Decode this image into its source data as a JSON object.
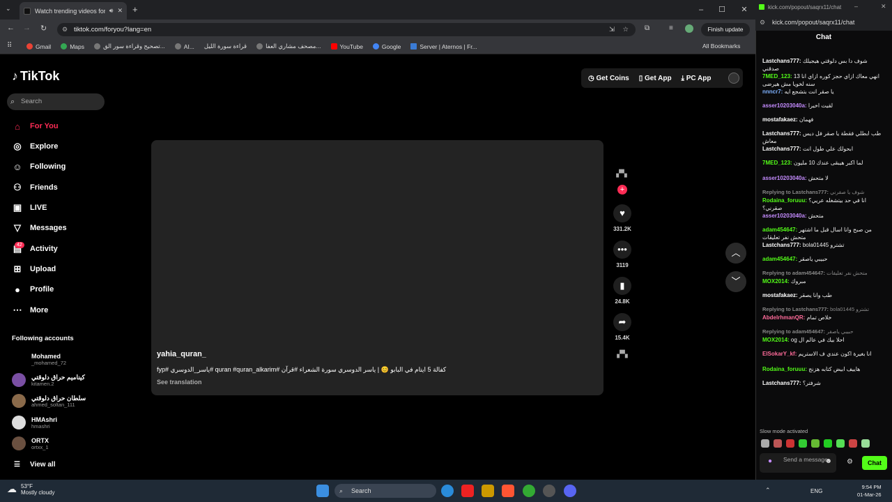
{
  "browser": {
    "tab_title": "Watch trending videos for y",
    "url": "tiktok.com/foryou?lang=en",
    "finish_update": "Finish update",
    "bookmarks": [
      "Gmail",
      "Maps",
      "تصحيح وقراءة سور الق...",
      "AI...",
      "قراءة سورة الليل",
      "مصحف مشاري العفا...",
      "YouTube",
      "Google",
      "Server | Aternos | Fr..."
    ],
    "all_bookmarks": "All Bookmarks"
  },
  "tiktok": {
    "logo": "TikTok",
    "search_placeholder": "Search",
    "nav": [
      {
        "label": "For You",
        "icon": "home-icon"
      },
      {
        "label": "Explore",
        "icon": "compass-icon"
      },
      {
        "label": "Following",
        "icon": "person-icon"
      },
      {
        "label": "Friends",
        "icon": "friends-icon"
      },
      {
        "label": "LIVE",
        "icon": "live-icon"
      },
      {
        "label": "Messages",
        "icon": "send-icon"
      },
      {
        "label": "Activity",
        "icon": "inbox-icon"
      },
      {
        "label": "Upload",
        "icon": "plus-square-icon"
      },
      {
        "label": "Profile",
        "icon": "profile-icon"
      },
      {
        "label": "More",
        "icon": "more-icon"
      }
    ],
    "activity_badge": "42",
    "following_header": "Following accounts",
    "accounts": [
      {
        "name": "Mohamed",
        "handle": "_mohamed_72"
      },
      {
        "name": "كيناميم حراق دلوقتي",
        "handle": "kitamen.2"
      },
      {
        "name": "سلطان حراق دلوقتي",
        "handle": "ahmed_soltan_111"
      },
      {
        "name": "HMAshri",
        "handle": "hmashri"
      },
      {
        "name": "ORTX",
        "handle": "ortxx_1"
      }
    ],
    "view_all": "View all",
    "top_buttons": [
      "Get Coins",
      "Get App",
      "PC App"
    ],
    "video": {
      "username": "yahia_quran_",
      "caption": "كفالة 5 ايتام في البابو 😊 | ياسر الدوسري سورة الشعراء #قرآن #quran #quran_alkarim #ياسر_الدوسري #fyp",
      "see_translation": "See translation",
      "likes": "331.2K",
      "comments": "3119",
      "saves": "24.8K",
      "shares": "15.4K"
    }
  },
  "chat": {
    "window_title": "kick.com/popout/saqrx11/chat",
    "url": "kick.com/popout/saqrx11/chat",
    "header": "Chat",
    "messages": [
      {
        "user": "Lastchans777:",
        "text": "شوف دا بس دلوقتي هيجيلك صدقني",
        "color": "#ffffff"
      },
      {
        "user": "7MED_123:",
        "text": "انهي معاك ازاي حجز كوره ازاي انا 13 سنه لخويا مش هيرضى",
        "color": "#53fc18"
      },
      {
        "user": "nnncr7:",
        "text": "يا صقر انت بتشجع ايه",
        "color": "#7fb2ff"
      },
      {
        "user": "asser10203040a:",
        "text": "لقيت اخيرا",
        "color": "#c58cff"
      },
      {
        "user": "mostafakaez:",
        "text": "فهمان",
        "color": "#ffffff"
      },
      {
        "user": "Lastchans777:",
        "text": "طب ابطلي فقطة يا صقر فل ديس معاش",
        "color": "#ffffff"
      },
      {
        "user": "Lastchans777:",
        "text": "ابحولك علي طول انت",
        "color": "#ffffff"
      },
      {
        "user": "7MED_123:",
        "text": "لما اكبر هيبقى عندك 10 مليون",
        "color": "#53fc18"
      },
      {
        "user": "asser10203040a:",
        "text": "لا متحش",
        "color": "#c58cff"
      },
      {
        "user": "Replying to Lastchans777:",
        "text": "شوف يا صقرني",
        "color": "#888888",
        "reply": true
      },
      {
        "user": "Rodaina_foruuu:",
        "text": "انا في حد بيتشغله عريي؟ صقرني؟",
        "color": "#53fc18"
      },
      {
        "user": "asser10203040a:",
        "text": "متحش",
        "color": "#c58cff"
      },
      {
        "user": "adam454647:",
        "text": "من صبح وانا اسال قبل ما اشتهر متحش نفر تعليقات",
        "color": "#53fc18"
      },
      {
        "user": "Lastchans777:",
        "text": "bola01445 تشترو",
        "color": "#ffffff"
      },
      {
        "user": "adam454647:",
        "text": "حبيبي ياصقر",
        "color": "#53fc18"
      },
      {
        "user": "Replying to adam454647:",
        "text": "متحش نفر تعليقات",
        "color": "#888888",
        "reply": true
      },
      {
        "user": "MOX2014:",
        "text": "مبروك",
        "color": "#53fc18"
      },
      {
        "user": "mostafakaez:",
        "text": "طب وانا يصقر",
        "color": "#ffffff"
      },
      {
        "user": "Replying to Lastchans777:",
        "text": "bola01445 تشترو",
        "color": "#888888",
        "reply": true
      },
      {
        "user": "AbdelrhmanQR:",
        "text": "خلاص تمام",
        "color": "#ff6b9a"
      },
      {
        "user": "Replying to adam454647:",
        "text": "حبيبي ياصقر",
        "color": "#888888",
        "reply": true
      },
      {
        "user": "MOX2014:",
        "text": "og احلا بيك في عالم ال",
        "color": "#53fc18"
      },
      {
        "user": "ElSokarY_kf:",
        "text": "انا بغيرة اكون عندي ف الاستريم",
        "color": "#ff6b9a"
      },
      {
        "user": "Rodaina_foruuu:",
        "text": "هاييف ابيض كتابه هزنج",
        "color": "#53fc18"
      },
      {
        "user": "Lastchans777:",
        "text": "شرفتر؟",
        "color": "#ffffff"
      }
    ],
    "slow_mode": "Slow mode activated",
    "send_placeholder": "Send a message",
    "chat_button": "Chat"
  },
  "taskbar": {
    "temp": "53°F",
    "weather": "Mostly cloudy",
    "search": "Search",
    "lang": "ENG",
    "time": "9:54 PM",
    "date": "01-Mar-26"
  }
}
